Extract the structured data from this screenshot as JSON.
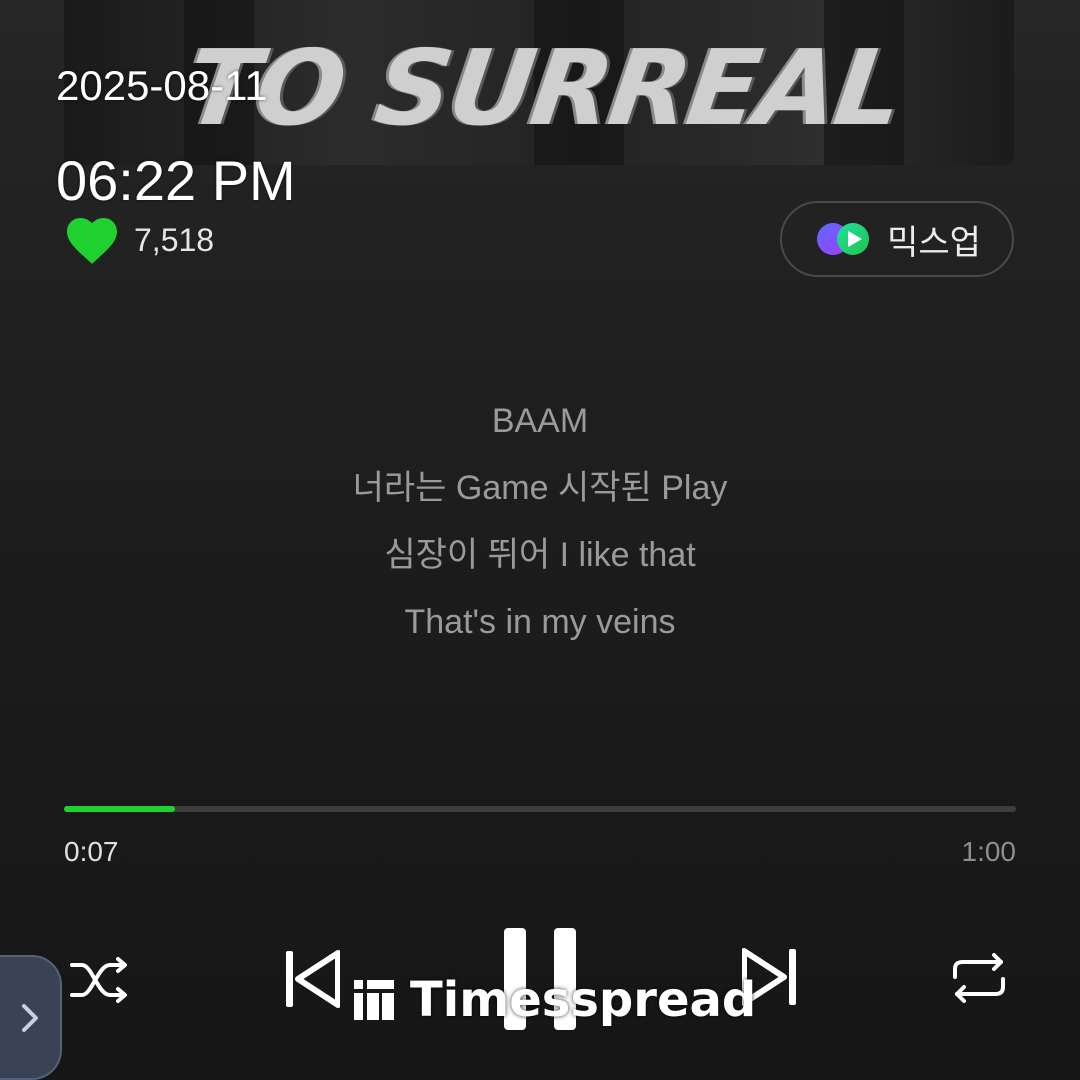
{
  "album": {
    "title_art": "TO SURREAL"
  },
  "overlay": {
    "date": "2025-08-11",
    "time": "06:22 PM"
  },
  "like": {
    "count": "7,518",
    "icon": "heart-icon",
    "color": "#1fd12f"
  },
  "mixup": {
    "label": "믹스업",
    "icon": "mixup-icon"
  },
  "lyrics": [
    "BAAM",
    "너라는 Game 시작된 Play",
    "심장이 뛰어 I like that",
    "That's in my veins"
  ],
  "progress": {
    "current": "0:07",
    "total": "1:00",
    "fraction": 0.1167,
    "color": "#1fd12f"
  },
  "controls": {
    "shuffle": "shuffle-icon",
    "previous": "skip-previous-icon",
    "pause": "pause-icon",
    "next": "skip-next-icon",
    "repeat": "repeat-icon"
  },
  "watermark": {
    "text": "Timesspread"
  }
}
